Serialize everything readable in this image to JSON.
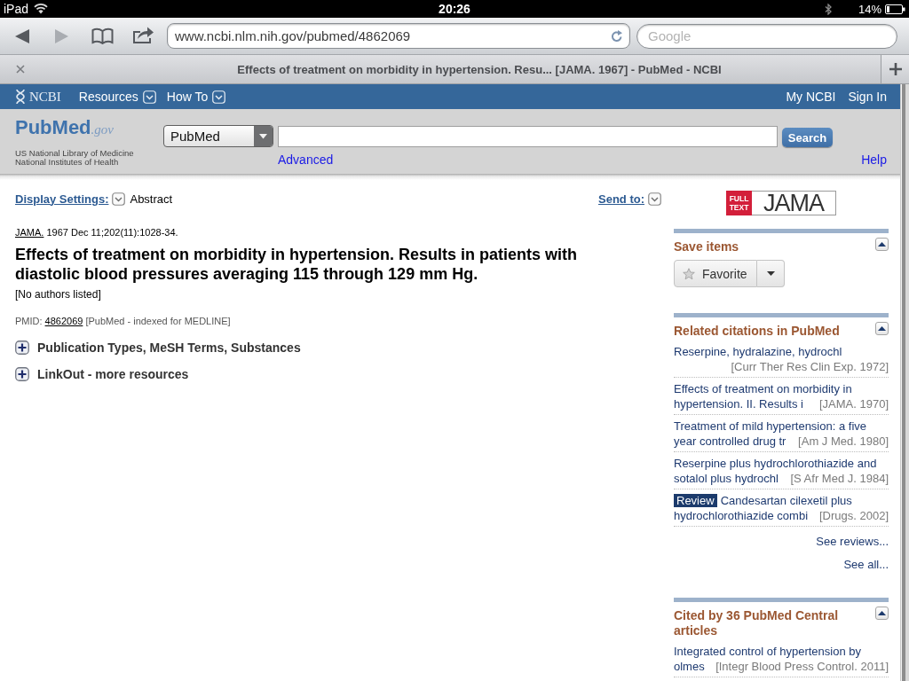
{
  "status_bar": {
    "device": "iPad",
    "time": "20:26",
    "battery": "14%"
  },
  "toolbar": {
    "back": {
      "disabled": false
    },
    "forward": {
      "disabled": true
    },
    "url": "www.ncbi.nlm.nih.gov/pubmed/4862069",
    "search_placeholder": "Google"
  },
  "tab": {
    "title": "Effects of treatment on morbidity in hypertension. Resu... [JAMA. 1967] - PubMed - NCBI"
  },
  "ncbi_bar": {
    "logo": "NCBI",
    "menus": [
      "Resources",
      "How To"
    ],
    "links": [
      "My NCBI",
      "Sign In"
    ]
  },
  "search_header": {
    "logo": {
      "name": "PubMed",
      "suffix": ".gov",
      "lines": [
        "US National Library of Medicine",
        "National Institutes of Health"
      ]
    },
    "database": "PubMed",
    "button": "Search",
    "advanced": "Advanced",
    "help": "Help"
  },
  "display_bar": {
    "settings_label": "Display Settings:",
    "format": "Abstract",
    "send_to": "Send to:"
  },
  "article": {
    "journal": "JAMA.",
    "citation": "1967 Dec 11;202(11):1028-34.",
    "title": "Effects of treatment on morbidity in hypertension. Results in patients with diastolic blood pressures averaging 115 through 129 mm Hg.",
    "authors": "[No authors listed]",
    "pmid_label": "PMID:",
    "pmid": "4862069",
    "status": "[PubMed - indexed for MEDLINE]",
    "sections": [
      {
        "label": "Publication Types, MeSH Terms, Substances",
        "expanded": false
      },
      {
        "label": "LinkOut - more resources",
        "expanded": false
      }
    ]
  },
  "sidebar": {
    "full_text": {
      "badge": "FULL TEXT",
      "journal": "JAMA"
    },
    "panels": [
      {
        "kind": "save",
        "title": "Save items",
        "expanded": true,
        "button": "Favorite"
      },
      {
        "kind": "citations",
        "title": "Related citations in PubMed",
        "expanded": true,
        "items": [
          {
            "title": "Reserpine, hydralazine, hydrochl",
            "source": "[Curr Ther Res Clin Exp. 1972]"
          },
          {
            "title": "Effects of treatment on morbidity in hypertension. II. Results i",
            "source": "[JAMA. 1970]"
          },
          {
            "title": "Treatment of mild hypertension: a five year controlled drug tr",
            "source": "[Am J Med. 1980]"
          },
          {
            "title": "Reserpine plus hydrochlorothiazide and sotalol plus hydrochl",
            "source": "[S Afr Med J. 1984]"
          },
          {
            "tag": "Review",
            "title": "Candesartan cilexetil plus hydrochlorothiazide combi",
            "source": "[Drugs. 2002]"
          }
        ],
        "links": [
          "See reviews...",
          "See all..."
        ]
      },
      {
        "kind": "citations",
        "title": "Cited by 36 PubMed Central articles",
        "expanded": true,
        "items": [
          {
            "title": "Integrated control of hypertension by olmes",
            "source": "[Integr Blood Press Control. 2011]"
          }
        ]
      }
    ]
  }
}
